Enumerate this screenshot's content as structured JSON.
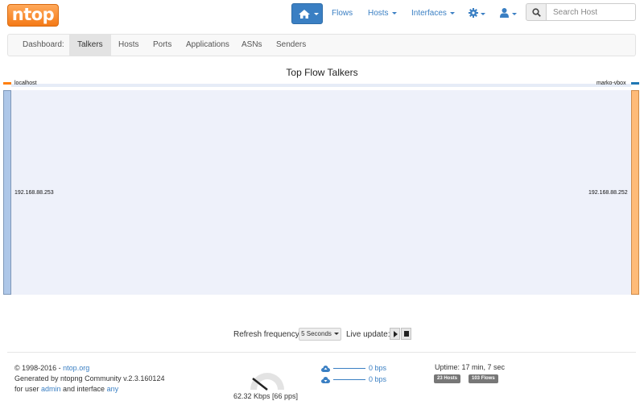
{
  "brand": "ntop",
  "nav": {
    "flows": "Flows",
    "hosts": "Hosts",
    "interfaces": "Interfaces",
    "icons": [
      "home-icon",
      "gear-icon",
      "user-icon",
      "search-icon"
    ]
  },
  "search": {
    "placeholder": "Search Host"
  },
  "tabs": [
    "Dashboard:",
    "Talkers",
    "Hosts",
    "Ports",
    "Applications",
    "ASNs",
    "Senders"
  ],
  "active_tab": "Talkers",
  "chart_title": "Top Flow Talkers",
  "sankey": {
    "sources": [
      {
        "group": "localhost",
        "host": "192.168.88.253",
        "color": "#aec7e8"
      }
    ],
    "targets": [
      {
        "group": "marko-vbox",
        "host": "192.168.88.252",
        "color": "#ffbb78"
      }
    ],
    "group_colors": {
      "localhost": "#ff7f0e",
      "marko-vbox": "#1f77b4"
    },
    "link_color": "#eef1fa"
  },
  "controls": {
    "refresh_label": "Refresh frequency:",
    "refresh_value": "5 Seconds",
    "live_label": "Live update:"
  },
  "footer": {
    "copyright": "© 1998-2016 - ",
    "site": "ntop.org",
    "generated": "Generated by ntopng Community v.2.3.160124",
    "for_user": "for user ",
    "user": "admin",
    "and_iface": " and interface ",
    "iface": "any",
    "throughput": "62.32 Kbps [66 pps]",
    "upload": "0 bps",
    "download": "0 bps",
    "uptime": "Uptime: 17 min, 7 sec",
    "hosts_badge": "23 Hosts",
    "flows_badge": "103 Flows"
  }
}
